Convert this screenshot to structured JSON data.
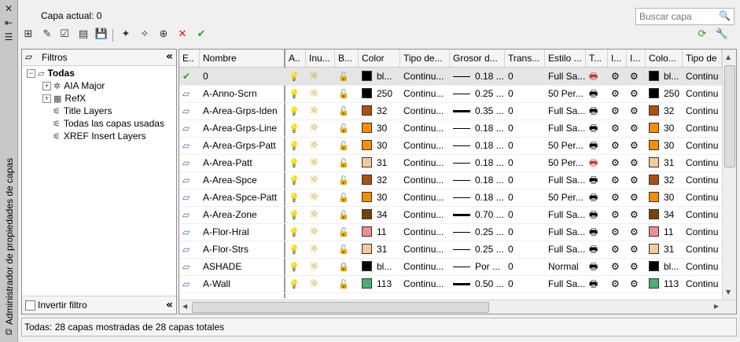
{
  "palette": {
    "title": "Administrador de propiedades de capas"
  },
  "header": {
    "current_layer": "Capa actual: 0",
    "search_placeholder": "Buscar capa"
  },
  "filters": {
    "title": "Filtros",
    "nodes": [
      "Todas",
      "AIA Major",
      "RefX",
      "Title Layers",
      "Todas las capas usadas",
      "XREF Insert Layers"
    ],
    "invert_label": "Invertir filtro"
  },
  "columns": [
    "E..",
    "Nombre",
    "A..",
    "Inu...",
    "B...",
    "Color",
    "Tipo de...",
    "Grosor d...",
    "Trans...",
    "Estilo ...",
    "T...",
    "I...",
    "I...",
    "Colo...",
    "Tipo de"
  ],
  "rows": [
    {
      "name": "0",
      "color_swatch": "#000000",
      "color": "bl...",
      "linetype": "Continu...",
      "lineweight": "0.18 ...",
      "lw_thick": false,
      "transparency": "0",
      "plotstyle": "Full Sa...",
      "no_plot": true,
      "vp_color": "bl...",
      "vp_linetype": "Continu",
      "current": true
    },
    {
      "name": "A-Anno-Scrn",
      "color_swatch": "#000000",
      "color": "250",
      "linetype": "Continu...",
      "lineweight": "0.25 ...",
      "lw_thick": false,
      "transparency": "0",
      "plotstyle": "50 Per...",
      "no_plot": false,
      "vp_color": "250",
      "vp_linetype": "Continu"
    },
    {
      "name": "A-Area-Grps-Iden",
      "color_swatch": "#b04e0f",
      "color": "32",
      "linetype": "Continu...",
      "lineweight": "0.35 ...",
      "lw_thick": true,
      "transparency": "0",
      "plotstyle": "Full Sa...",
      "no_plot": false,
      "vp_color": "32",
      "vp_linetype": "Continu"
    },
    {
      "name": "A-Area-Grps-Line",
      "color_swatch": "#ff8c00",
      "color": "30",
      "linetype": "Continu...",
      "lineweight": "0.18 ...",
      "lw_thick": false,
      "transparency": "0",
      "plotstyle": "Full Sa...",
      "no_plot": false,
      "vp_color": "30",
      "vp_linetype": "Continu"
    },
    {
      "name": "A-Area-Grps-Patt",
      "color_swatch": "#ff8c00",
      "color": "30",
      "linetype": "Continu...",
      "lineweight": "0.18 ...",
      "lw_thick": false,
      "transparency": "0",
      "plotstyle": "50 Per...",
      "no_plot": false,
      "vp_color": "30",
      "vp_linetype": "Continu"
    },
    {
      "name": "A-Area-Patt",
      "color_swatch": "#f5c89a",
      "color": "31",
      "linetype": "Continu...",
      "lineweight": "0.18 ...",
      "lw_thick": false,
      "transparency": "0",
      "plotstyle": "50 Per...",
      "no_plot": true,
      "vp_color": "31",
      "vp_linetype": "Continu"
    },
    {
      "name": "A-Area-Spce",
      "color_swatch": "#b04e0f",
      "color": "32",
      "linetype": "Continu...",
      "lineweight": "0.18 ...",
      "lw_thick": false,
      "transparency": "0",
      "plotstyle": "Full Sa...",
      "no_plot": false,
      "vp_color": "32",
      "vp_linetype": "Continu"
    },
    {
      "name": "A-Area-Spce-Patt",
      "color_swatch": "#ff8c00",
      "color": "30",
      "linetype": "Continu...",
      "lineweight": "0.18 ...",
      "lw_thick": false,
      "transparency": "0",
      "plotstyle": "50 Per...",
      "no_plot": false,
      "vp_color": "30",
      "vp_linetype": "Continu"
    },
    {
      "name": "A-Area-Zone",
      "color_swatch": "#7a4200",
      "color": "34",
      "linetype": "Continu...",
      "lineweight": "0.70 ...",
      "lw_thick": true,
      "transparency": "0",
      "plotstyle": "Full Sa...",
      "no_plot": false,
      "vp_color": "34",
      "vp_linetype": "Continu"
    },
    {
      "name": "A-Flor-Hral",
      "color_swatch": "#f08c8c",
      "color": "11",
      "linetype": "Continu...",
      "lineweight": "0.25 ...",
      "lw_thick": false,
      "transparency": "0",
      "plotstyle": "Full Sa...",
      "no_plot": false,
      "vp_color": "11",
      "vp_linetype": "Continu"
    },
    {
      "name": "A-Flor-Strs",
      "color_swatch": "#f5c89a",
      "color": "31",
      "linetype": "Continu...",
      "lineweight": "0.25 ...",
      "lw_thick": false,
      "transparency": "0",
      "plotstyle": "Full Sa...",
      "no_plot": false,
      "vp_color": "31",
      "vp_linetype": "Continu"
    },
    {
      "name": "ASHADE",
      "color_swatch": "#000000",
      "color": "bl...",
      "linetype": "Continu...",
      "lineweight": "Por ...",
      "lw_thick": false,
      "transparency": "0",
      "plotstyle": "Normal",
      "no_plot": false,
      "locked": true,
      "vp_color": "bl...",
      "vp_linetype": "Continu"
    },
    {
      "name": "A-Wall",
      "color_swatch": "#4caf72",
      "color": "113",
      "linetype": "Continu...",
      "lineweight": "0.50 ...",
      "lw_thick": true,
      "transparency": "0",
      "plotstyle": "Full Sa...",
      "no_plot": false,
      "vp_color": "113",
      "vp_linetype": "Continu"
    }
  ],
  "status": "Todas: 28 capas mostradas de 28 capas totales"
}
